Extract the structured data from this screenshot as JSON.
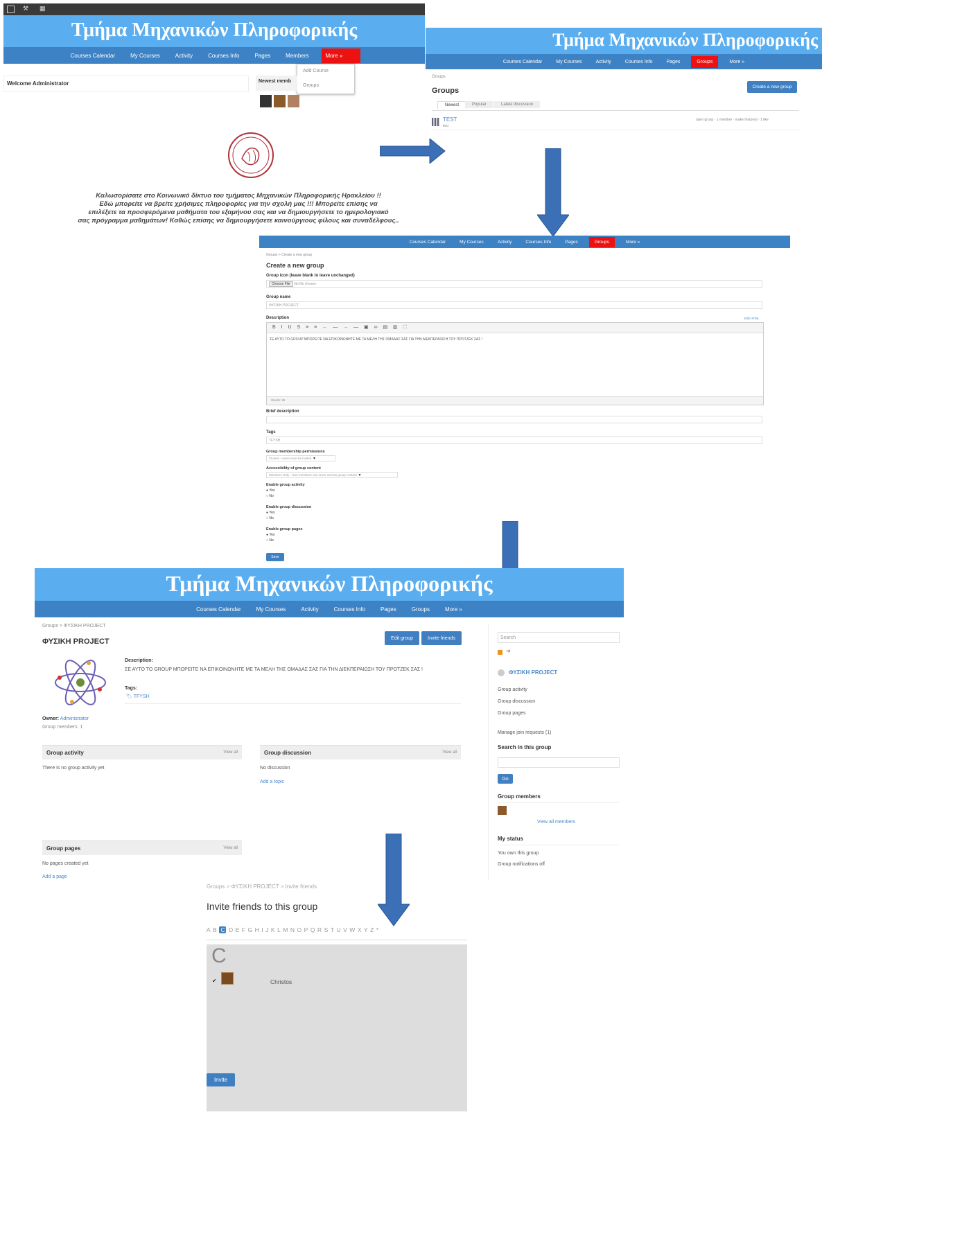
{
  "site_title": "Τμήμα Μηχανικών Πληροφορικής",
  "nav": {
    "calendar": "Courses Calendar",
    "my_courses": "My Courses",
    "activity": "Activity",
    "courses_info": "Courses Info",
    "pages": "Pages",
    "members": "Members",
    "groups": "Groups",
    "more": "More »"
  },
  "panel1": {
    "welcome": "Welcome Administrator",
    "newest_members": "Newest memb",
    "menu_items": [
      "Add Course",
      "Groups"
    ],
    "welcome_text": [
      "Καλωσορίσατε στο Κοινωνικό δίκτυο του τμήματος Μηχανικών Πληροφορικής Ηρακλείου !!",
      "Εδώ μπορείτε να βρείτε χρήσιμες πληροφορίες για την σχολή μας !!! Μπορείτε επίσης να",
      "επιλέξετε τα προσφερόμενα μαθήματα του εξαμήνου σας και να δημιουργήσετε το ημερολογιακό",
      "σας πρόγραμμα μαθημάτων! Καθώς επίσης να δημιουργήσετε καινούργιους φίλους και συναδέλφους.."
    ]
  },
  "panel2": {
    "crumb": "Groups",
    "title": "Groups",
    "create_btn": "Create a new group",
    "tabs": [
      "Newest",
      "Popular",
      "Latest discussion"
    ],
    "item_name": "TEST",
    "item_sub": "test",
    "item_meta": "open group · 1 member · make featured · 1 like"
  },
  "panel3": {
    "crumb": "Groups > Create a new group",
    "title": "Create a new group",
    "icon_label": "Group icon (leave blank to leave unchanged)",
    "choose_file": "Choose File",
    "no_file": "No file chosen",
    "name_label": "Group name",
    "name_value": "ΦΥΣΙΚΗ PROJECT",
    "desc_label": "Description",
    "edit_html": "Edit HTML",
    "toolbar_icons": "B I U S ≡ ≡ ← — → — ▣ ∞ ▤ ▥ ⛶",
    "desc_value": "ΣΕ ΑΥΤΟ ΤΟ GROUP ΜΠΟΡΕΙΤΕ ΝΑ ΕΠΙΚΟΙΝΩΝΗΤΕ ΜΕ ΤΑ ΜΕΛΗ ΤΗΣ ΟΜΑΔΑΣ ΣΑΣ ΓΙΑ ΤΗΝ ΔΙΕΚΠΕΡΑΙΩΣΗ ΤΟΥ ΠΡΟΤΖΕΚ ΣΑΣ !",
    "words": "Words: 26",
    "brief_label": "Brief description",
    "tags_label": "Tags",
    "tags_value": "TFYSH",
    "membership_label": "Group membership permissions",
    "membership_value": "Closed - Users must be invited",
    "access_label": "Accessibility of group content",
    "access_value": "Members Only - Non-members can never access group content",
    "activity_label": "Enable group activity",
    "discussion_label": "Enable group discussion",
    "pages_label": "Enable group pages",
    "yes": "Yes",
    "no": "No",
    "save": "Save"
  },
  "panel4": {
    "crumb": "Groups > ΦΥΣΙΚΗ PROJECT",
    "title": "ΦΥΣΙΚΗ PROJECT",
    "edit_btn": "Edit group",
    "invite_btn": "Invite friends",
    "desc_label": "Description:",
    "desc_value": "ΣΕ ΑΥΤΟ ΤΟ GROUP ΜΠΟΡΕΙΤΕ ΝΑ ΕΠΙΚΟΙΝΩΝΗΤΕ ΜΕ ΤΑ ΜΕΛΗ ΤΗΣ ΟΜΑΔΑΣ ΣΑΣ ΓΙΑ ΤΗΝ ΔΙΕΚΠΕΡΑΙΩΣΗ ΤΟΥ ΠΡΟΤΖΕΚ ΣΑΣ !",
    "tags_label": "Tags:",
    "tags_value": "TFYSH",
    "owner_label": "Owner:",
    "owner_value": "Administrator",
    "members_line": "Group members: 1",
    "activity_title": "Group activity",
    "activity_empty": "There is no group activity yet",
    "discussion_title": "Group discussion",
    "discussion_empty": "No discussion",
    "add_topic": "Add a topic",
    "pages_title": "Group pages",
    "pages_empty": "No pages created yet",
    "add_page": "Add a page",
    "view_all": "View all",
    "sidebar": {
      "search_placeholder": "Search",
      "group_name": "ΦΥΣΙΚΗ PROJECT",
      "links": [
        "Group activity",
        "Group discussion",
        "Group pages"
      ],
      "join_requests": "Manage join requests (1)",
      "search_title": "Search in this group",
      "go": "Go",
      "members_title": "Group members",
      "view_all_members": "View all members",
      "status_title": "My status",
      "own": "You own this group",
      "notifications": "Group notifications off"
    }
  },
  "panel5": {
    "crumb": "Groups > ΦΥΣΙΚΗ PROJECT > Invite friends",
    "title": "Invite friends to this group",
    "alphabet": [
      "A",
      "B",
      "C",
      "D",
      "E",
      "F",
      "G",
      "H",
      "I",
      "J",
      "K",
      "L",
      "M",
      "N",
      "O",
      "P",
      "Q",
      "R",
      "S",
      "T",
      "U",
      "V",
      "W",
      "X",
      "Y",
      "Z",
      "*"
    ],
    "selected_letter": "C",
    "letter_heading": "C",
    "friend_name": "Christos",
    "invite_btn": "Invite"
  },
  "colors": {
    "banner": "#5aaef0",
    "nav": "#3d82c4",
    "active_tab": "#e11111",
    "arrow": "#3b6fb6"
  }
}
